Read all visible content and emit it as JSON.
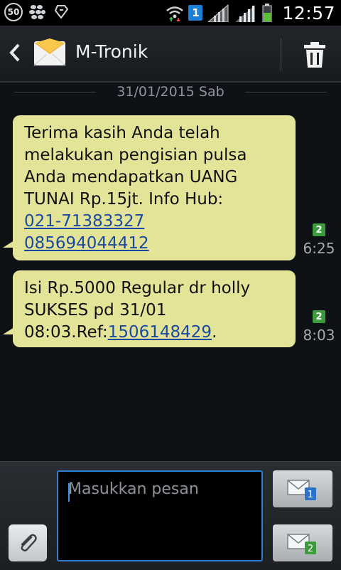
{
  "status_bar": {
    "battery_percent": "50",
    "sim_active": "1",
    "time": "12:57"
  },
  "header": {
    "title": "M-Tronik"
  },
  "conversation": {
    "date": "31/01/2015 Sab",
    "messages": [
      {
        "text_before": "Terima kasih Anda telah melakukan pengisian pulsa Anda mendapatkan UANG TUNAI Rp.15jt. Info Hub:",
        "link1": "021-71383327",
        "link2": "085694044412",
        "sim": "2",
        "time": "6:25"
      },
      {
        "text_before": "Isi Rp.5000 Regular dr holly SUKSES pd 31/01 08:03.Ref:",
        "link": "1506148429",
        "text_after": ".",
        "sim": "2",
        "time": "8:03"
      }
    ]
  },
  "composer": {
    "placeholder": "Masukkan pesan",
    "send_sim1": "1",
    "send_sim2": "2"
  },
  "colors": {
    "bubble": "#e4e499",
    "link": "#1a4aa0",
    "accent": "#2e7fd0",
    "sim2": "#3c9b3b"
  }
}
